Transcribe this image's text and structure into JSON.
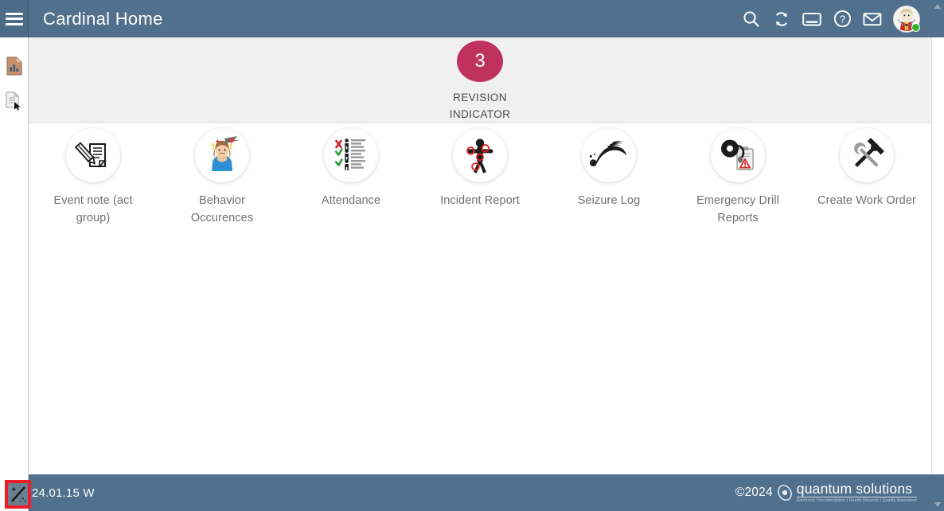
{
  "header": {
    "title": "Cardinal Home",
    "menu_icon": "hamburger-menu-icon",
    "actions": [
      {
        "name": "search-icon",
        "label": "Search"
      },
      {
        "name": "sync-icon",
        "label": "Refresh"
      },
      {
        "name": "window-icon",
        "label": "Window"
      },
      {
        "name": "help-icon",
        "label": "Help"
      },
      {
        "name": "mail-icon",
        "label": "Messages"
      }
    ],
    "avatar": {
      "name": "user-avatar",
      "status": "online",
      "status_color": "#34b233"
    }
  },
  "sidebar": {
    "items": [
      {
        "name": "reports-icon",
        "label": "Reports"
      },
      {
        "name": "documents-icon",
        "label": "Documents"
      }
    ]
  },
  "revision": {
    "count": "3",
    "line1": "REVISION",
    "line2": "INDICATOR",
    "color": "#bf3260"
  },
  "tiles": [
    {
      "icon": "event-note-icon",
      "label": "Event note (act group)"
    },
    {
      "icon": "behavior-occurrences-icon",
      "label": "Behavior Occurences"
    },
    {
      "icon": "attendance-icon",
      "label": "Attendance"
    },
    {
      "icon": "incident-report-icon",
      "label": "Incident Report"
    },
    {
      "icon": "seizure-log-icon",
      "label": "Seizure Log"
    },
    {
      "icon": "emergency-drill-icon",
      "label": "Emergency Drill Reports"
    },
    {
      "icon": "create-work-order-icon",
      "label": "Create Work Order"
    }
  ],
  "footer": {
    "version": "24.01.15 W",
    "copyright": "©2024",
    "brand_name": "quantum solutions",
    "brand_tagline": "Electronic Documentation  |  Health Records  |  Quality Assurance",
    "magic_icon": "magic-wand-icon",
    "highlight_color": "#ee1c25"
  },
  "theme": {
    "header_bg": "#50708d",
    "band_bg": "#f0f0f0",
    "content_bg": "#ffffff",
    "label_color": "#6f6f6f"
  }
}
